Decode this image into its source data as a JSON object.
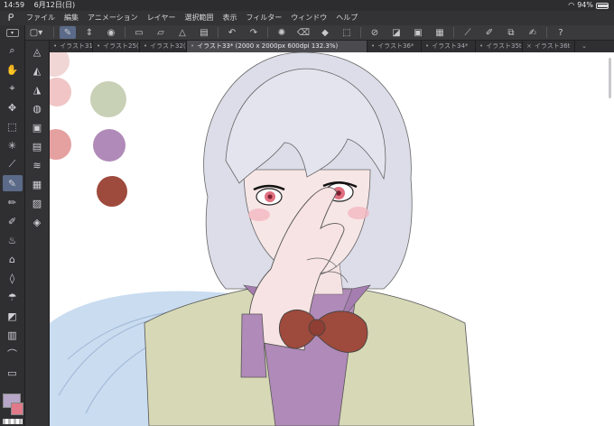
{
  "status": {
    "time": "14:59",
    "date": "6月12日(日)",
    "battery": "94%"
  },
  "menu": [
    "ファイル",
    "編集",
    "アニメーション",
    "レイヤー",
    "選択範囲",
    "表示",
    "フィルター",
    "ウィンドウ",
    "ヘルプ"
  ],
  "tabs": [
    {
      "label": "イラスト31(9",
      "active": false
    },
    {
      "label": "イラスト25(9",
      "active": false
    },
    {
      "label": "イラスト32(m",
      "active": false
    },
    {
      "label": "イラスト33* (2000 x 2000px 600dpi 132.3%)",
      "active": true
    },
    {
      "label": "イラスト36*",
      "active": false
    },
    {
      "label": "イラスト34*",
      "active": false
    },
    {
      "label": "イラスト35t",
      "active": false
    },
    {
      "label": "イラスト36t",
      "active": false
    }
  ],
  "colors": {
    "accent": "#5a6a88",
    "main_color": "#b7a6c8",
    "sub_color": "#e07a8a",
    "swatch_sage": "#c8d0b6",
    "swatch_lavender": "#b08ab8",
    "swatch_brown": "#9e4a3c",
    "swatch_pink": "#f1c5c5",
    "swatch_rose": "#e5a0a0"
  }
}
